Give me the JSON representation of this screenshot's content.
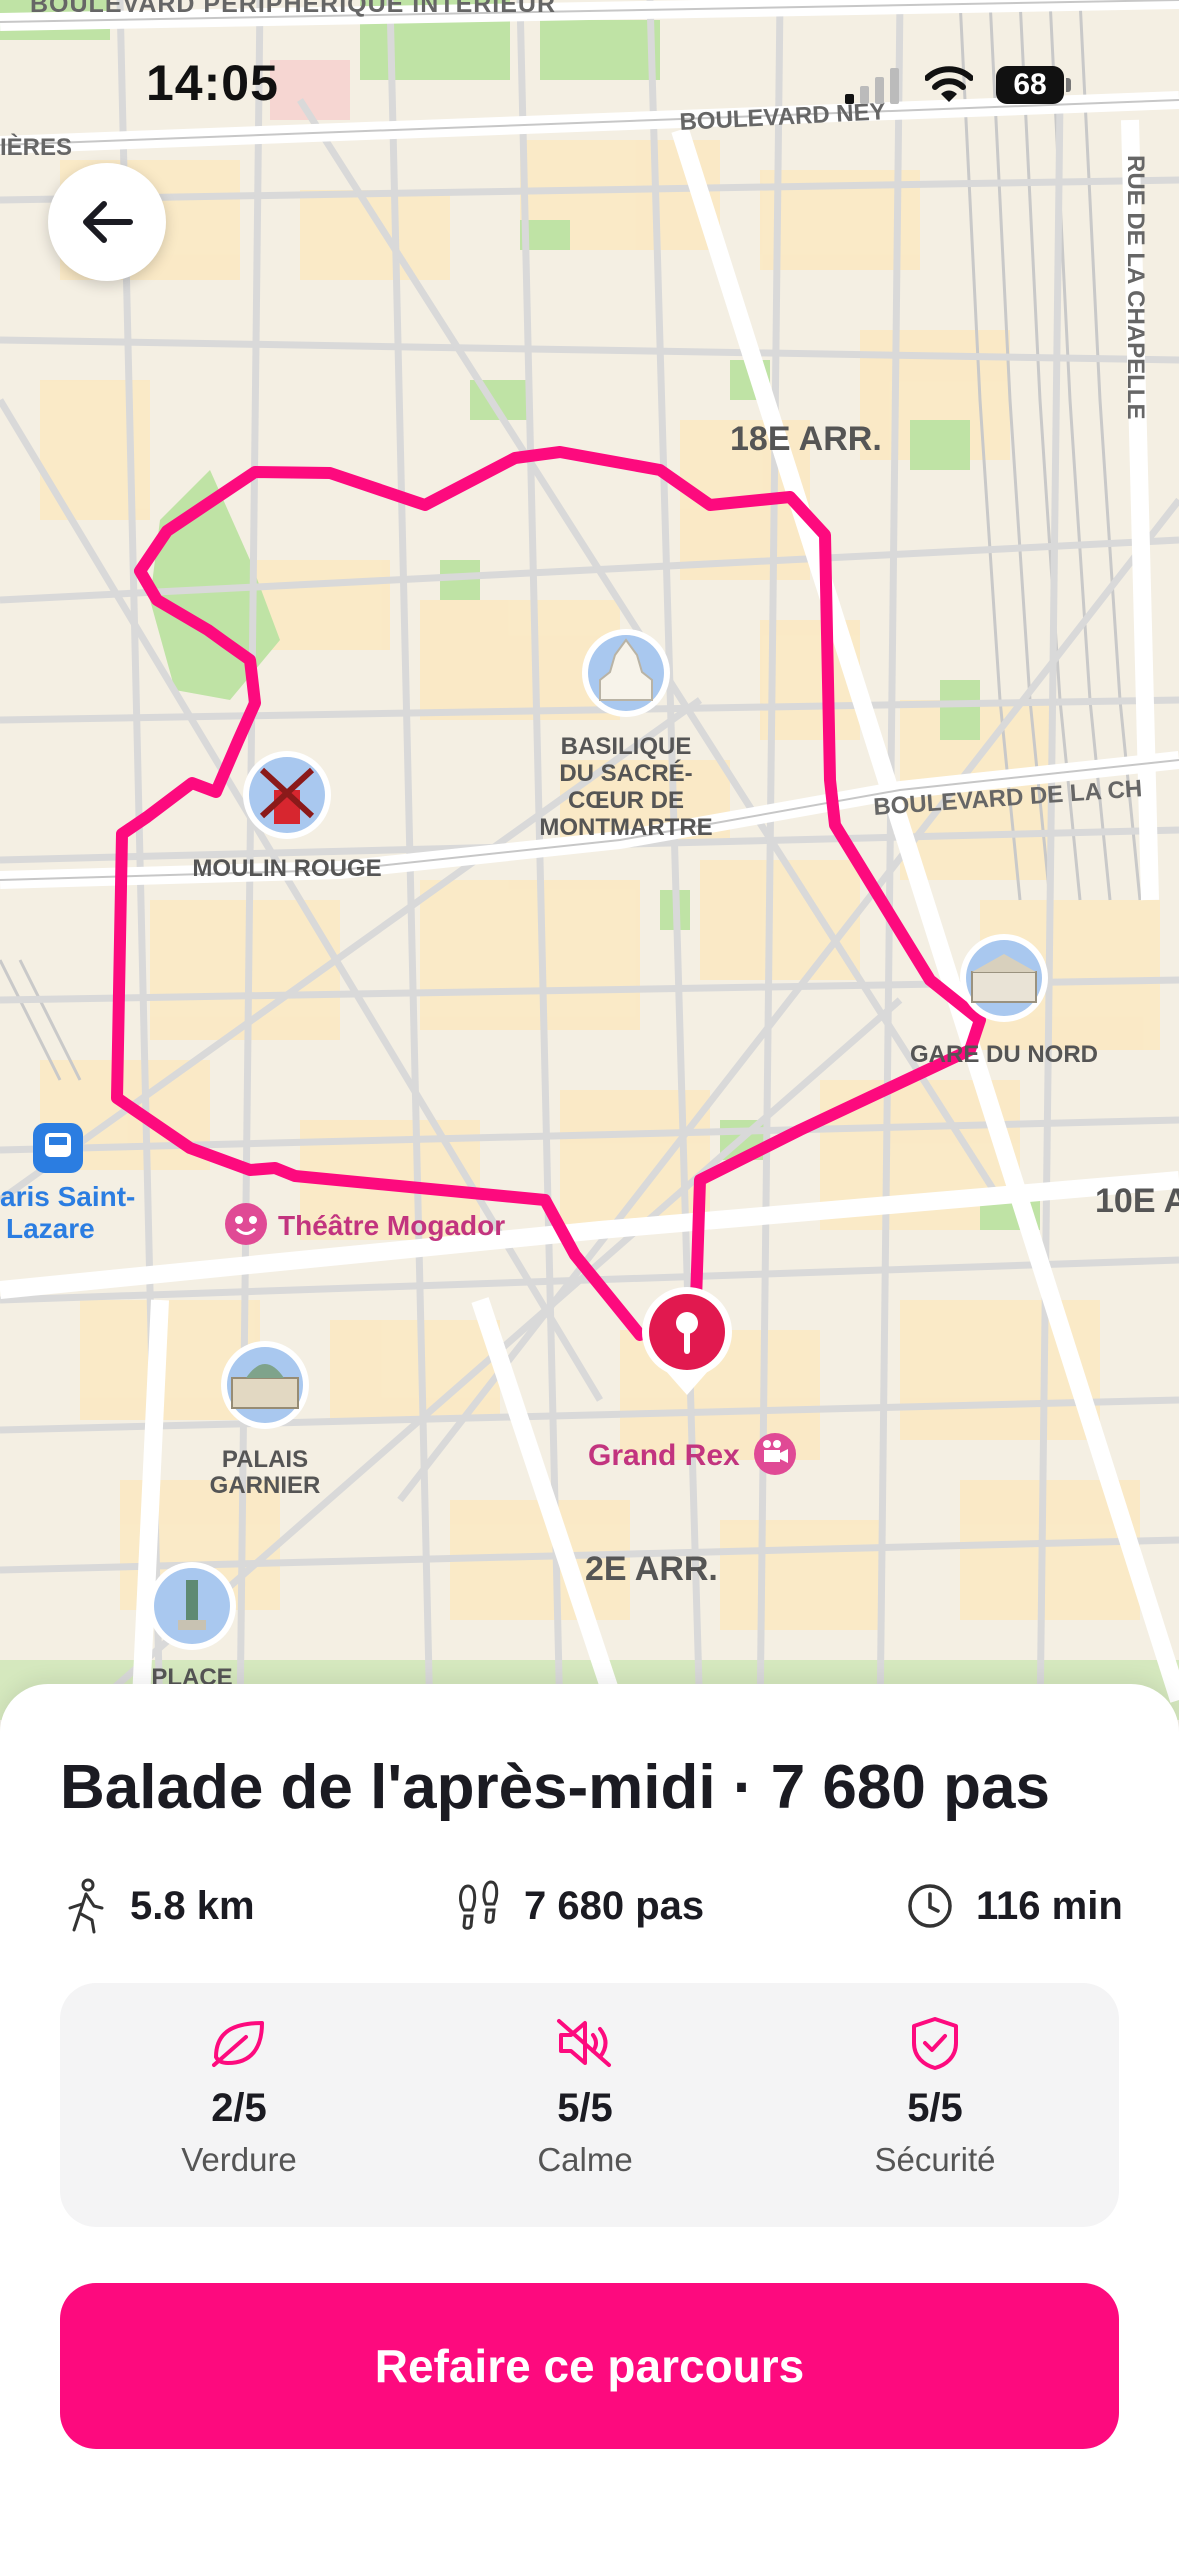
{
  "status_bar": {
    "time": "14:05",
    "battery": "68"
  },
  "map": {
    "streets": [
      "BOULEVARD PÉRIPHÉRIQUE INTÉRIEUR",
      "BOULEVARD NEY",
      "RUE DE LA CHAPELLE",
      "BOULEVARD DE LA CH",
      "IÈRES"
    ],
    "districts": [
      "18E ARR.",
      "10E A",
      "2E ARR."
    ],
    "poi": {
      "moulin_rouge": "MOULIN ROUGE",
      "sacre_coeur": [
        "BASILIQUE",
        "DU SACRÉ-",
        "CŒUR DE",
        "MONTMARTRE"
      ],
      "gare_du_nord": "GARE DU NORD",
      "saint_lazare": [
        "aris Saint-",
        "Lazare"
      ],
      "theatre_mogador": "Théâtre Mogador",
      "palais_garnier": [
        "PALAIS",
        "GARNIER"
      ],
      "grand_rex": "Grand Rex",
      "place": "PLACE"
    },
    "route_color": "#fd0a7e"
  },
  "walk": {
    "title": "Balade de l'après-midi · 7 680 pas",
    "distance": "5.8 km",
    "steps": "7 680 pas",
    "duration": "116 min"
  },
  "scores": [
    {
      "icon": "leaf-icon",
      "value": "2/5",
      "label": "Verdure"
    },
    {
      "icon": "speaker-muted-icon",
      "value": "5/5",
      "label": "Calme"
    },
    {
      "icon": "shield-check-icon",
      "value": "5/5",
      "label": "Sécurité"
    }
  ],
  "cta_label": "Refaire ce parcours",
  "colors": {
    "accent": "#fd0a7e",
    "text": "#1b1b22"
  }
}
